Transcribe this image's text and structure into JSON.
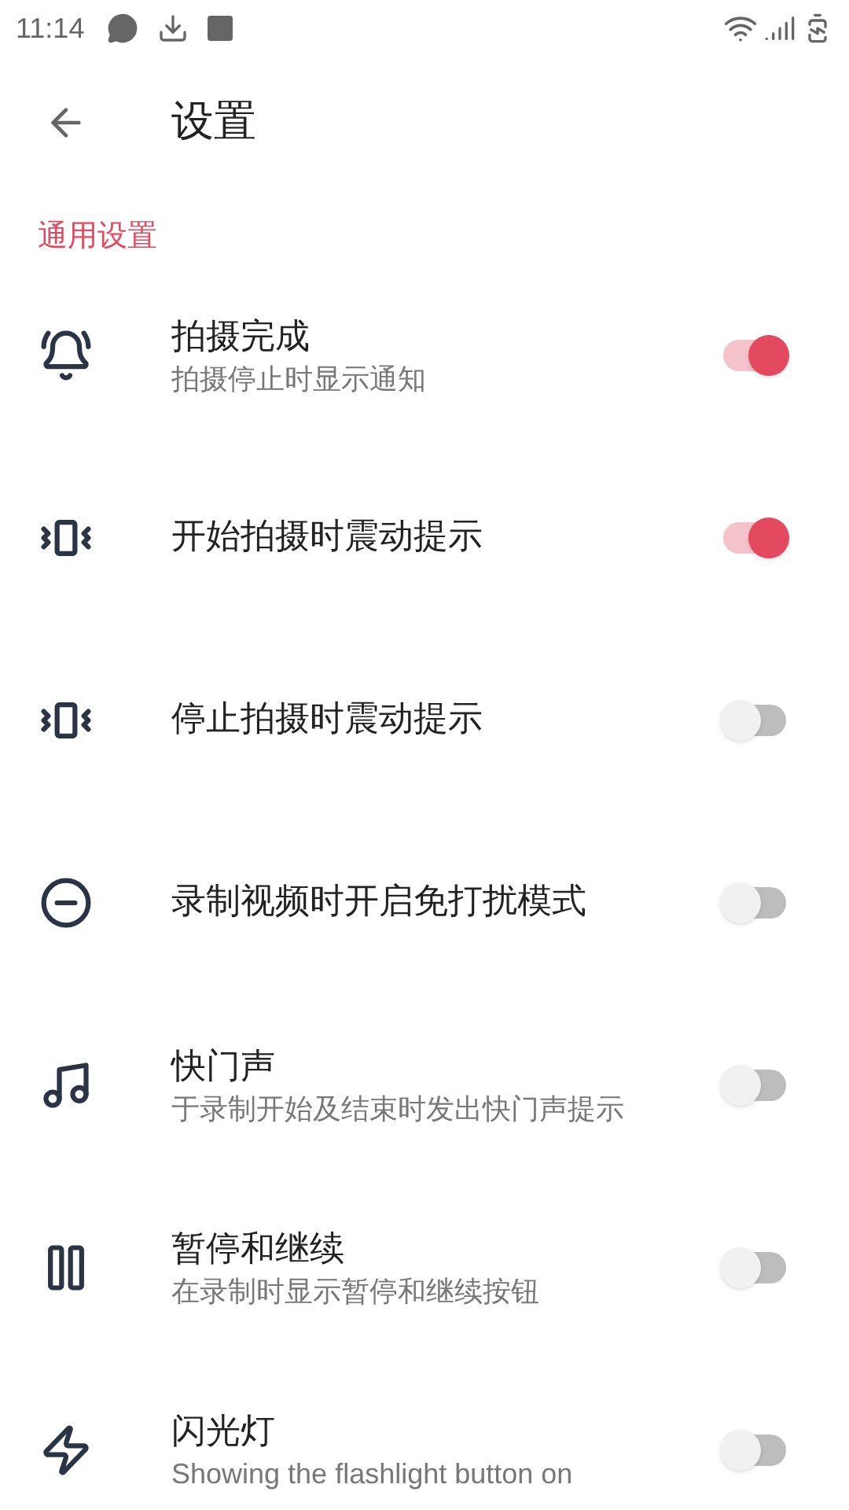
{
  "status_bar": {
    "time": "11:14"
  },
  "toolbar": {
    "title": "设置"
  },
  "section": {
    "title": "通用设置"
  },
  "items": [
    {
      "title": "拍摄完成",
      "subtitle": "拍摄停止时显示通知",
      "on": true
    },
    {
      "title": "开始拍摄时震动提示",
      "on": true
    },
    {
      "title": "停止拍摄时震动提示",
      "on": false
    },
    {
      "title": "录制视频时开启免打扰模式",
      "on": false
    },
    {
      "title": "快门声",
      "subtitle": "于录制开始及结束时发出快门声提示",
      "on": false
    },
    {
      "title": "暂停和继续",
      "subtitle": "在录制时显示暂停和继续按钮",
      "on": false
    },
    {
      "title": "闪光灯",
      "subtitle": "Showing the flashlight button on",
      "on": false
    }
  ]
}
